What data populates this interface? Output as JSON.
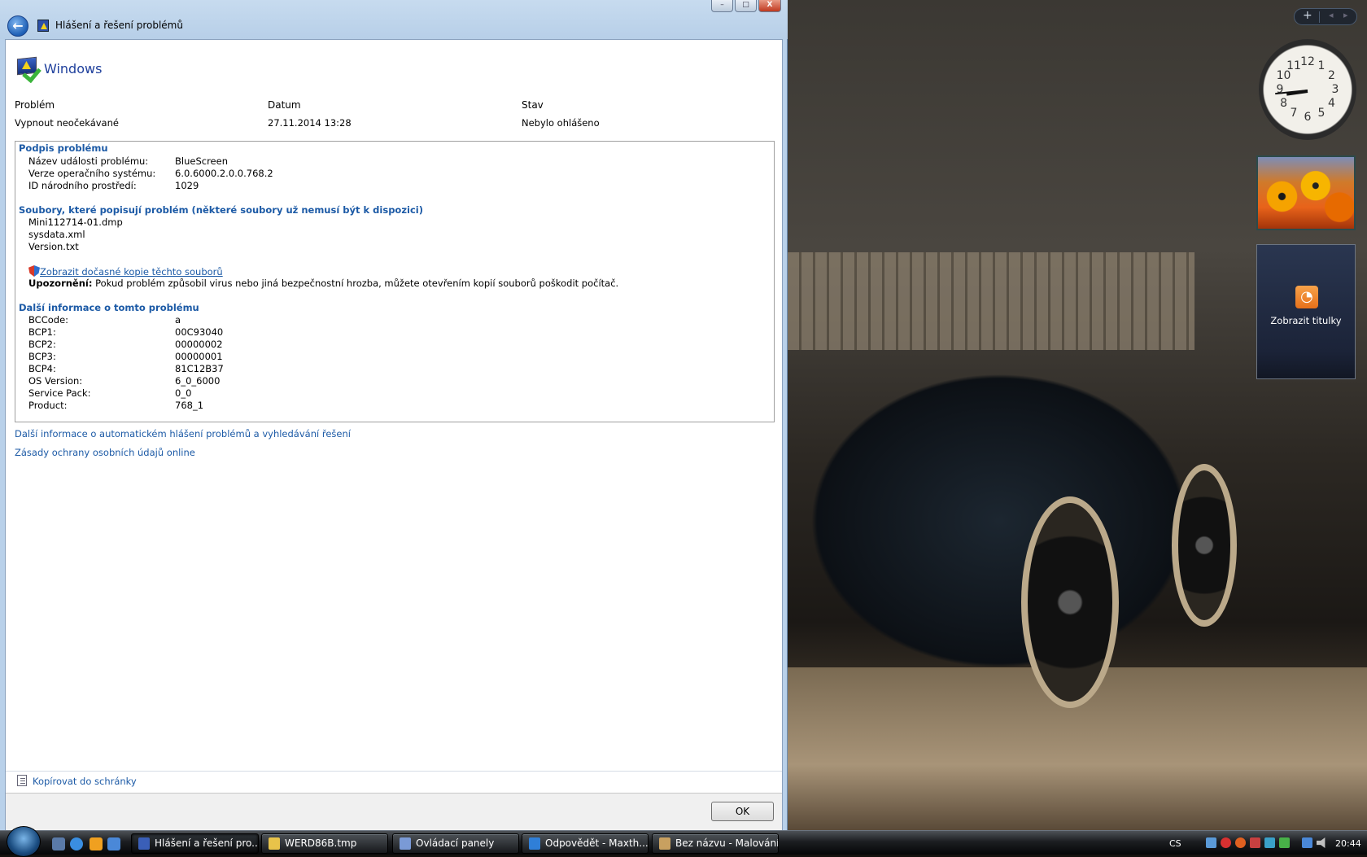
{
  "window": {
    "title": "Hlášení a řešení problémů",
    "minimize": "–",
    "maximize": "□",
    "close": "X",
    "back": "←"
  },
  "header": {
    "brand": "Windows"
  },
  "summary": {
    "col_problem": "Problém",
    "col_date": "Datum",
    "col_status": "Stav",
    "problem": "Vypnout neočekávané",
    "date": "27.11.2014 13:28",
    "status": "Nebylo ohlášeno"
  },
  "signature": {
    "title": "Podpis problému",
    "rows": [
      {
        "k": "Název události problému:",
        "v": "BlueScreen"
      },
      {
        "k": "Verze operačního systému:",
        "v": "6.0.6000.2.0.0.768.2"
      },
      {
        "k": "ID národního prostředí:",
        "v": "1029"
      }
    ]
  },
  "files": {
    "title": "Soubory, které popisují problém (některé soubory už nemusí být k dispozici)",
    "items": [
      "Mini112714-01.dmp",
      "sysdata.xml",
      "Version.txt"
    ],
    "link": "Zobrazit dočasné kopie těchto souborů",
    "warning_label": "Upozornění:",
    "warning": " Pokud problém způsobil virus nebo jiná bezpečnostní hrozba, můžete otevřením kopií souborů poškodit počítač."
  },
  "more": {
    "title": "Další informace o tomto problému",
    "rows": [
      {
        "k": "BCCode:",
        "v": "a"
      },
      {
        "k": "BCP1:",
        "v": "00C93040"
      },
      {
        "k": "BCP2:",
        "v": "00000002"
      },
      {
        "k": "BCP3:",
        "v": "00000001"
      },
      {
        "k": "BCP4:",
        "v": "81C12B37"
      },
      {
        "k": "OS Version:",
        "v": "6_0_6000"
      },
      {
        "k": "Service Pack:",
        "v": "0_0"
      },
      {
        "k": "Product:",
        "v": "768_1"
      }
    ]
  },
  "links": [
    "Další informace o automatickém hlášení problémů a vyhledávání řešení",
    "Zásady ochrany osobních údajů online"
  ],
  "footer": {
    "copy": "Kopírovat do schránky",
    "ok": "OK"
  },
  "sidebar": {
    "add": "+",
    "prev": "◂",
    "next": "▸",
    "clock_time": "20:44",
    "clock_numbers": [
      "12",
      "1",
      "2",
      "3",
      "4",
      "5",
      "6",
      "7",
      "8",
      "9",
      "10",
      "11"
    ],
    "rss_text": "Zobrazit titulky"
  },
  "taskbar": {
    "buttons": [
      {
        "label": "Hlášení a řešení pro...",
        "icon": "problem-reports-icon",
        "color": "#3a5fb8"
      },
      {
        "label": "WERD86B.tmp",
        "icon": "folder-icon",
        "color": "#e8c34a"
      },
      {
        "label": "Ovládací panely",
        "icon": "control-panel-icon",
        "color": "#7a9ad6"
      },
      {
        "label": "Odpovědět - Maxth...",
        "icon": "maxthon-icon",
        "color": "#2f7fd8"
      },
      {
        "label": "Bez názvu - Malování",
        "icon": "paint-icon",
        "color": "#c8a060"
      }
    ],
    "language": "CS",
    "time": "20:44"
  }
}
